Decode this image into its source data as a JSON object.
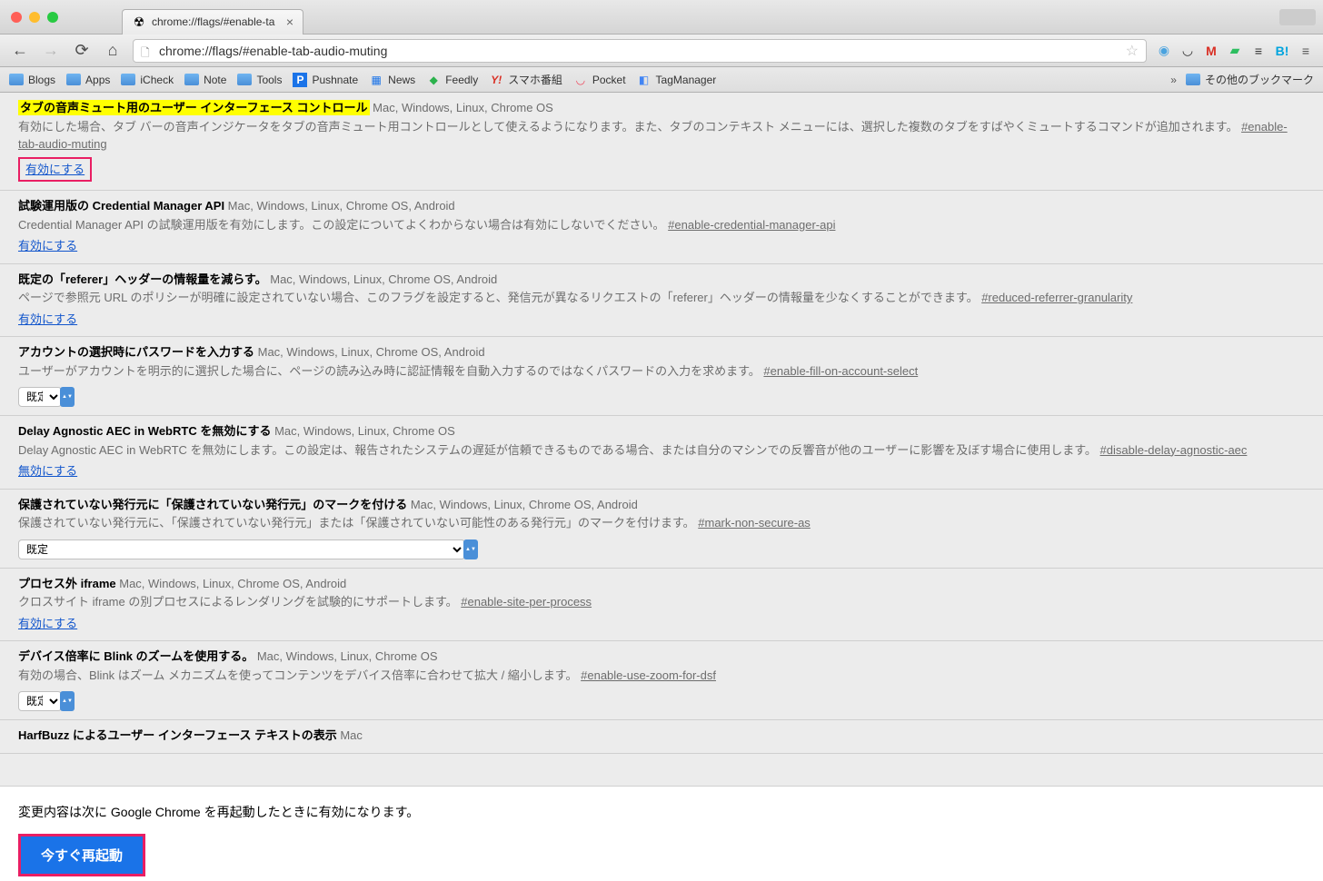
{
  "tab": {
    "title": "chrome://flags/#enable-ta",
    "close": "×"
  },
  "omnibox": {
    "text": "chrome://flags/#enable-tab-audio-muting"
  },
  "bookmarks": {
    "items": [
      "Blogs",
      "Apps",
      "iCheck",
      "Note",
      "Tools",
      "Pushnate",
      "News",
      "Feedly",
      "スマホ番組",
      "Pocket",
      "TagManager"
    ],
    "overflow": "»",
    "other": "その他のブックマーク"
  },
  "selectDefault": "既定",
  "flags": [
    {
      "title": "タブの音声ミュート用のユーザー インターフェース コントロール",
      "platforms": "Mac, Windows, Linux, Chrome OS",
      "desc": "有効にした場合、タブ バーの音声インジケータをタブの音声ミュート用コントロールとして使えるようになります。また、タブのコンテキスト メニューには、選択した複数のタブをすばやくミュートするコマンドが追加されます。",
      "hash": "#enable-tab-audio-muting",
      "action": "有効にする",
      "highlighted": true,
      "boxed": true
    },
    {
      "title": "試験運用版の Credential Manager API",
      "platforms": "Mac, Windows, Linux, Chrome OS, Android",
      "desc": "Credential Manager API の試験運用版を有効にします。この設定についてよくわからない場合は有効にしないでください。",
      "hash": "#enable-credential-manager-api",
      "action": "有効にする"
    },
    {
      "title": "既定の「referer」ヘッダーの情報量を減らす。",
      "platforms": "Mac, Windows, Linux, Chrome OS, Android",
      "desc": "ページで参照元 URL のポリシーが明確に設定されていない場合、このフラグを設定すると、発信元が異なるリクエストの「referer」ヘッダーの情報量を少なくすることができます。",
      "hash": "#reduced-referrer-granularity",
      "action": "有効にする"
    },
    {
      "title": "アカウントの選択時にパスワードを入力する",
      "platforms": "Mac, Windows, Linux, Chrome OS, Android",
      "desc": "ユーザーがアカウントを明示的に選択した場合に、ページの読み込み時に認証情報を自動入力するのではなくパスワードの入力を求めます。",
      "hash": "#enable-fill-on-account-select",
      "select": "small"
    },
    {
      "title": "Delay Agnostic AEC in WebRTC を無効にする",
      "platforms": "Mac, Windows, Linux, Chrome OS",
      "desc": "Delay Agnostic AEC in WebRTC を無効にします。この設定は、報告されたシステムの遅延が信頼できるものである場合、または自分のマシンでの反響音が他のユーザーに影響を及ぼす場合に使用します。",
      "hash": "#disable-delay-agnostic-aec",
      "action": "無効にする"
    },
    {
      "title": "保護されていない発行元に「保護されていない発行元」のマークを付ける",
      "platforms": "Mac, Windows, Linux, Chrome OS, Android",
      "desc": "保護されていない発行元に、「保護されていない発行元」または「保護されていない可能性のある発行元」のマークを付けます。",
      "hash": "#mark-non-secure-as",
      "select": "large"
    },
    {
      "title": "プロセス外 iframe",
      "platforms": "Mac, Windows, Linux, Chrome OS, Android",
      "desc": "クロスサイト iframe の別プロセスによるレンダリングを試験的にサポートします。",
      "hash": "#enable-site-per-process",
      "action": "有効にする"
    },
    {
      "title": "デバイス倍率に Blink のズームを使用する。",
      "platforms": "Mac, Windows, Linux, Chrome OS",
      "desc": "有効の場合、Blink はズーム メカニズムを使ってコンテンツをデバイス倍率に合わせて拡大 / 縮小します。",
      "hash": "#enable-use-zoom-for-dsf",
      "select": "small"
    },
    {
      "title": "HarfBuzz によるユーザー インターフェース テキストの表示",
      "platforms": "Mac",
      "desc": "",
      "hash": "",
      "cut": true
    }
  ],
  "footer": {
    "text": "変更内容は次に Google Chrome を再起動したときに有効になります。",
    "button": "今すぐ再起動"
  }
}
